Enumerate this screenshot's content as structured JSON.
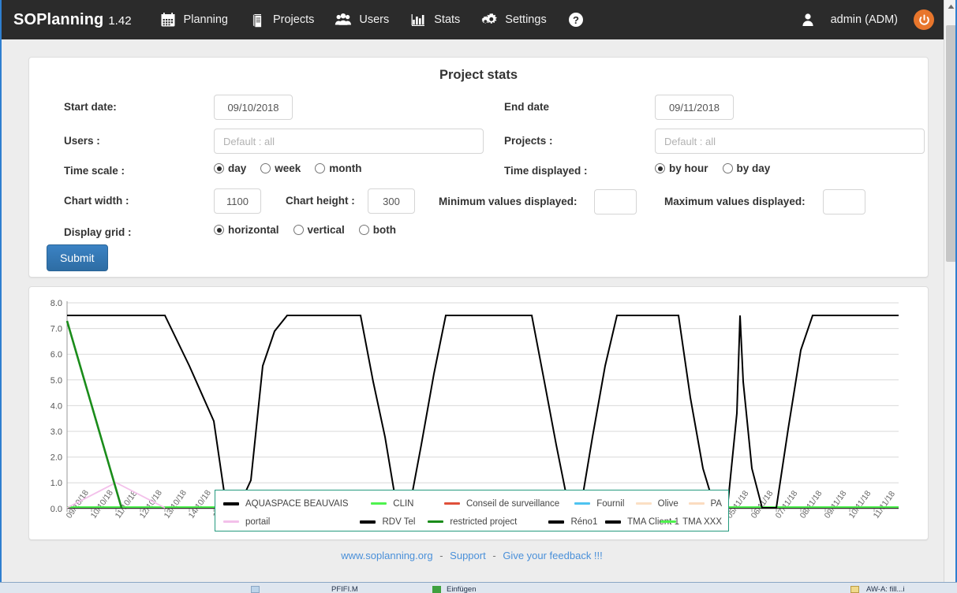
{
  "navbar": {
    "brand": "SOPlanning",
    "version": "1.42",
    "items": [
      {
        "label": "Planning",
        "icon": "calendar-icon"
      },
      {
        "label": "Projects",
        "icon": "book-icon"
      },
      {
        "label": "Users",
        "icon": "users-icon"
      },
      {
        "label": "Stats",
        "icon": "bar-chart-icon"
      },
      {
        "label": "Settings",
        "icon": "gears-icon"
      },
      {
        "label": "",
        "icon": "help-icon"
      }
    ],
    "user": "admin (ADM)",
    "user_icon": "user-icon",
    "logout_icon": "power-icon"
  },
  "form": {
    "title": "Project stats",
    "start_date_label": "Start date:",
    "start_date_value": "09/10/2018",
    "end_date_label": "End date",
    "end_date_value": "09/11/2018",
    "users_label": "Users :",
    "users_placeholder": "Default : all",
    "users_value": "",
    "projects_label": "Projects :",
    "projects_placeholder": "Default : all",
    "projects_value": "",
    "time_scale_label": "Time scale :",
    "time_scale_options": [
      {
        "label": "day",
        "selected": true
      },
      {
        "label": "week",
        "selected": false
      },
      {
        "label": "month",
        "selected": false
      }
    ],
    "time_displayed_label": "Time displayed :",
    "time_displayed_options": [
      {
        "label": "by hour",
        "selected": true
      },
      {
        "label": "by day",
        "selected": false
      }
    ],
    "chart_width_label": "Chart width :",
    "chart_width_value": "1100",
    "chart_height_label": "Chart height :",
    "chart_height_value": "300",
    "min_values_label": "Minimum values displayed:",
    "min_values_value": "",
    "max_values_label": "Maximum values displayed:",
    "max_values_value": "",
    "display_grid_label": "Display grid :",
    "display_grid_options": [
      {
        "label": "horizontal",
        "selected": true
      },
      {
        "label": "vertical",
        "selected": false
      },
      {
        "label": "both",
        "selected": false
      }
    ],
    "submit_label": "Submit"
  },
  "chart_data": {
    "type": "line",
    "title": "",
    "xlabel": "",
    "ylabel": "",
    "ylim": [
      0.0,
      8.0
    ],
    "ytick_labels": [
      "0.0",
      "1.0",
      "2.0",
      "3.0",
      "4.0",
      "5.0",
      "6.0",
      "7.0",
      "8.0"
    ],
    "ytick_values": [
      0,
      1,
      2,
      3,
      4,
      5,
      6,
      7,
      8
    ],
    "grid": "horizontal",
    "legend_position": "bottom-center",
    "legend_border_color": "#249a7e",
    "x_tick_count": 34,
    "x_tick_label_suffix": "/18",
    "x_tick_labels_clipped": true,
    "series": [
      {
        "name": "AQUASPACE BEAUVAIS",
        "color": "#000000",
        "x": [
          0,
          1,
          4,
          5,
          8,
          9,
          10,
          11,
          12,
          15,
          16,
          19,
          20,
          21,
          22,
          23,
          24,
          25,
          26,
          27,
          28,
          33
        ],
        "values": [
          7.5,
          7.5,
          7.5,
          0.0,
          0.0,
          6.8,
          7.5,
          7.5,
          7.5,
          0.0,
          0.0,
          7.5,
          7.5,
          7.5,
          0.0,
          0.0,
          7.5,
          0.0,
          7.5,
          0.0,
          7.5,
          7.5
        ]
      },
      {
        "name": "CLIN",
        "color": "#4ef24e",
        "values_constant": 0.05
      },
      {
        "name": "Conseil de surveillance",
        "color": "#e0503a",
        "values_constant": 0.0
      },
      {
        "name": "Fournil",
        "color": "#4ec3f0",
        "values_constant": 0.0
      },
      {
        "name": "Olive",
        "color": "#fbe0c4",
        "values_constant": 0.0
      },
      {
        "name": "PA",
        "color": "#fbdcc0",
        "values_constant": 0.0
      },
      {
        "name": "portail",
        "color": "#f3c0ea",
        "x": [
          0,
          2,
          4
        ],
        "values": [
          0.0,
          1.0,
          0.0
        ]
      },
      {
        "name": "RDV Tel",
        "color": "#000000",
        "values_constant": 0.0
      },
      {
        "name": "restricted project",
        "color": "#1a8c1a",
        "x": [
          0,
          2.2
        ],
        "values": [
          7.3,
          0.0
        ]
      },
      {
        "name": "Réno1",
        "color": "#000000",
        "values_constant": 0.0
      },
      {
        "name": "TMA Client 1",
        "color": "#000000",
        "values_constant": 0.0
      },
      {
        "name": "TMA XXX",
        "color": "#4ef24e",
        "values_constant": 0.0
      }
    ],
    "legend_entries": [
      {
        "label": "AQUASPACE BEAUVAIS",
        "color": "#000000"
      },
      {
        "label": "CLIN",
        "color": "#4ef24e"
      },
      {
        "label": "Conseil de surveillance",
        "color": "#e0503a"
      },
      {
        "label": "Fournil",
        "color": "#4ec3f0"
      },
      {
        "label": "Olive",
        "color": "#fbe0c4"
      },
      {
        "label": "PA",
        "color": "#fbdcc0"
      },
      {
        "label": "portail",
        "color": "#f3c0ea"
      },
      {
        "label": "RDV Tel",
        "color": "#000000"
      },
      {
        "label": "restricted project",
        "color": "#1a8c1a"
      },
      {
        "label": "Réno1",
        "color": "#000000"
      },
      {
        "label": "TMA Client 1",
        "color": "#000000"
      },
      {
        "label": "TMA XXX",
        "color": "#4ef24e"
      }
    ]
  },
  "footer": {
    "site": "www.soplanning.org",
    "sep": "-",
    "support": "Support",
    "feedback": "Give your feedback !!!"
  },
  "taskbar": {
    "items": [
      "PFIFI.M",
      "Einfügen",
      "AW-A: fill...i"
    ]
  }
}
